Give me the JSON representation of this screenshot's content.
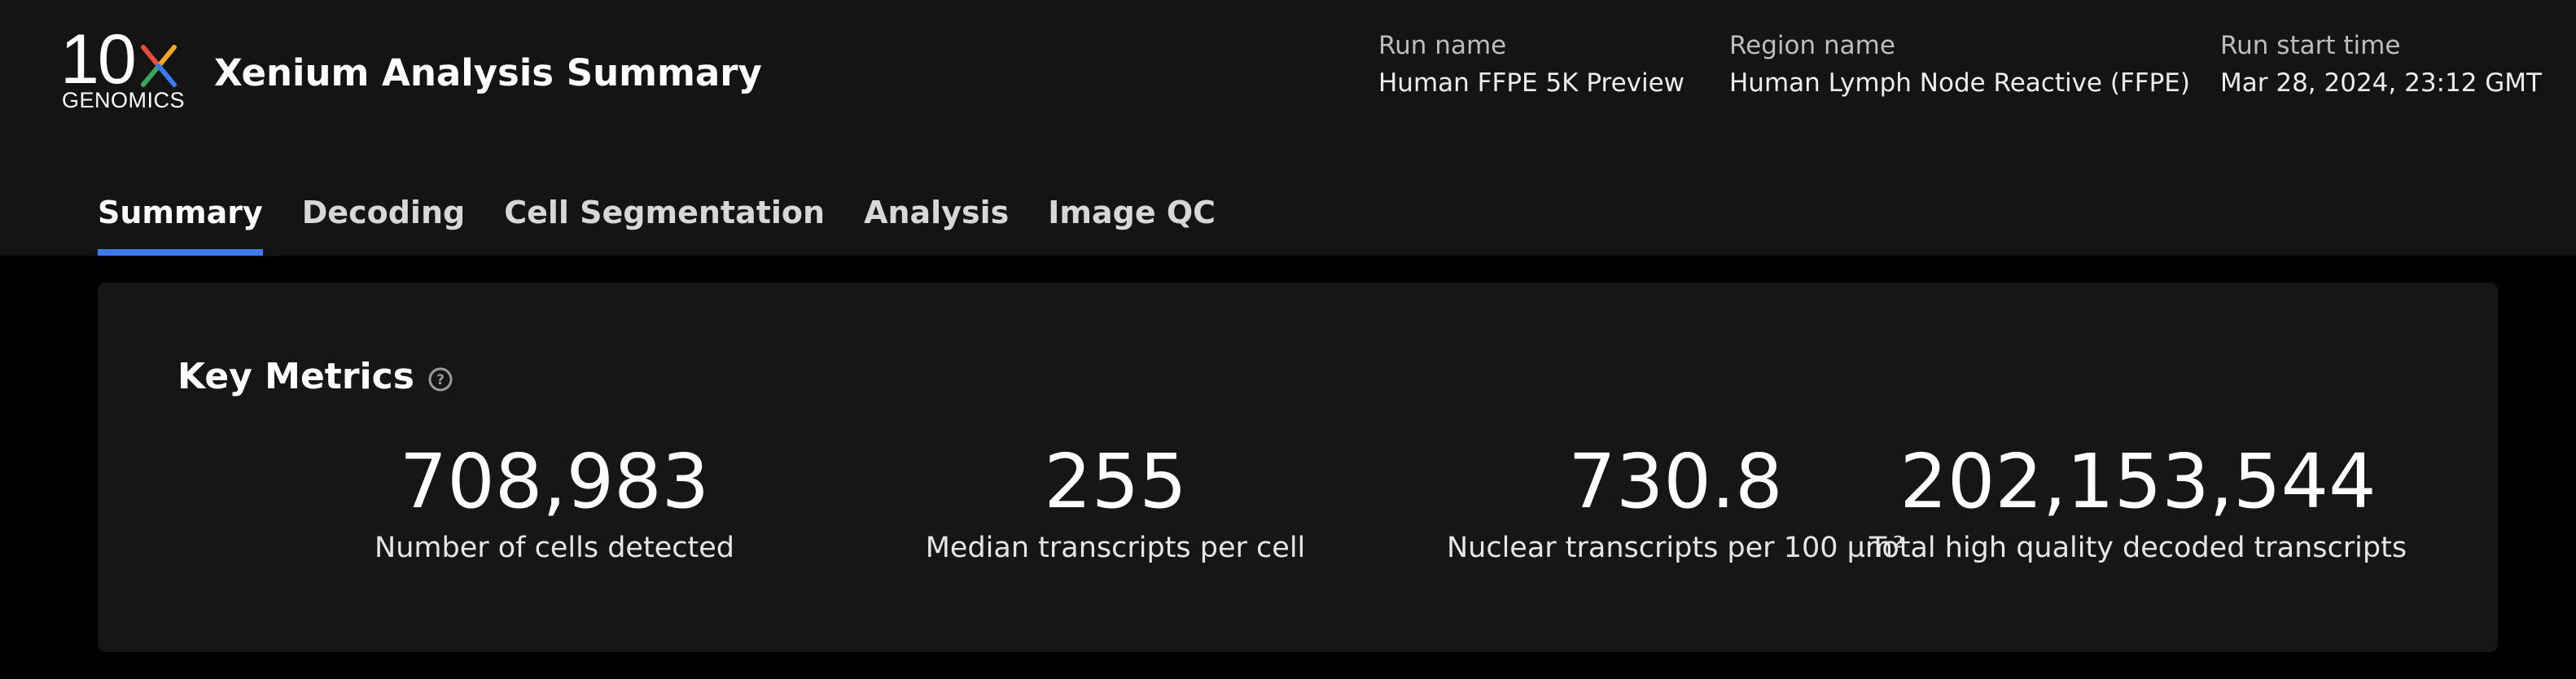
{
  "logo": {
    "mark": "10",
    "wordmark": "GENOMICS",
    "x_colors": [
      "#e94b3c",
      "#f5a623",
      "#3aa55d",
      "#3b7bf2"
    ]
  },
  "app_title": "Xenium Analysis Summary",
  "run_info": [
    {
      "label": "Run name",
      "value": "Human FFPE 5K Preview"
    },
    {
      "label": "Region name",
      "value": "Human Lymph Node Reactive (FFPE)"
    },
    {
      "label": "Run start time",
      "value": "Mar 28, 2024, 23:12 GMT"
    }
  ],
  "tabs": [
    {
      "label": "Summary",
      "active": true
    },
    {
      "label": "Decoding",
      "active": false
    },
    {
      "label": "Cell Segmentation",
      "active": false
    },
    {
      "label": "Analysis",
      "active": false
    },
    {
      "label": "Image QC",
      "active": false
    }
  ],
  "key_metrics": {
    "title": "Key Metrics",
    "help_icon": "question-circle-icon",
    "metrics": [
      {
        "value": "708,983",
        "label": "Number of cells detected"
      },
      {
        "value": "255",
        "label": "Median transcripts per cell"
      },
      {
        "value": "730.8",
        "label": "Nuclear transcripts per 100 µm²"
      },
      {
        "value": "202,153,544",
        "label": "Total high quality decoded transcripts"
      }
    ]
  },
  "colors": {
    "header_bg": "#141414",
    "page_bg": "#000000",
    "card_bg": "#161616",
    "accent": "#3b7bf2"
  }
}
